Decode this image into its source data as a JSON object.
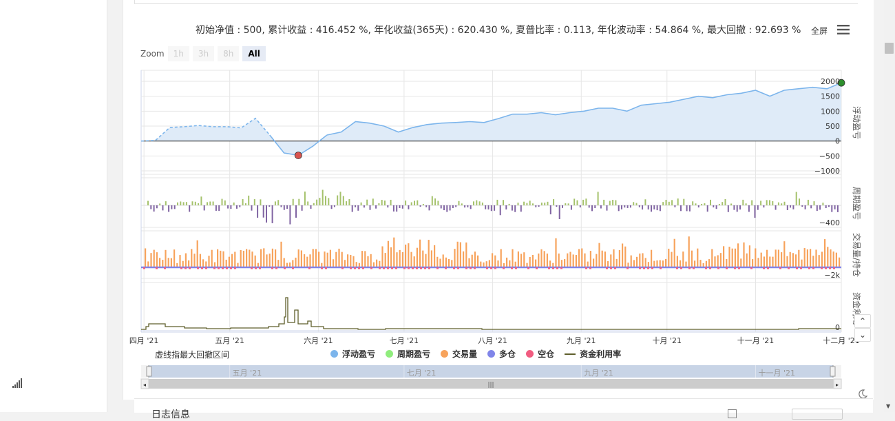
{
  "summary": {
    "text": "初始净值 : 500, 累计收益 : 416.452 %, 年化收益(365天) : 620.430 %, 夏普比率 : 0.113, 年化波动率 : 54.864 %, 最大回撤 : 92.693 %"
  },
  "toolbar": {
    "fullscreen_label": "全屏",
    "menu_icon": "hamburger-menu-icon"
  },
  "zoom": {
    "label": "Zoom",
    "buttons": [
      "1h",
      "3h",
      "8h",
      "All"
    ],
    "active": "All"
  },
  "note": "虚线指最大回撤区间",
  "legend": [
    {
      "label": "浮动盈亏",
      "color": "#7cb5ec",
      "shape": "dot"
    },
    {
      "label": "周期盈亏",
      "color": "#90ed7d",
      "shape": "dot"
    },
    {
      "label": "交易量",
      "color": "#f7a35c",
      "shape": "dot"
    },
    {
      "label": "多仓",
      "color": "#8085e9",
      "shape": "dot"
    },
    {
      "label": "空仓",
      "color": "#f15c80",
      "shape": "dot"
    },
    {
      "label": "资金利用率",
      "color": "#5e5e2a",
      "shape": "line"
    }
  ],
  "colors": {
    "equity_line": "#7cb5ec",
    "equity_fill": "#dfebf8",
    "period_pos": "#a5c26b",
    "period_neg": "#8064a2",
    "volume": "#f7a35c",
    "long": "#8085e9",
    "short": "#f15c80",
    "utilization": "#5e5e2a",
    "marker_max": "#2d8f2d",
    "marker_min": "#d9534f"
  },
  "bottom": {
    "title": "日志信息"
  },
  "chart_data": {
    "type": "line",
    "x_ticks": [
      "四月 '21",
      "五月 '21",
      "六月 '21",
      "七月 '21",
      "八月 '21",
      "九月 '21",
      "十月 '21",
      "十一月 '21",
      "十二月 '21"
    ],
    "navigator_ticks": [
      "五月 '21",
      "七月 '21",
      "九月 '21",
      "十一月 '21"
    ],
    "panes": [
      {
        "name": "浮动盈亏",
        "y_ticks": [
          "2000",
          "1500",
          "1000",
          "500",
          "0",
          "−500",
          "−1000"
        ],
        "ylim": [
          -1000,
          2000
        ],
        "x": [
          "2021-03-31",
          "2021-04-05",
          "2021-04-10",
          "2021-04-15",
          "2021-04-20",
          "2021-04-25",
          "2021-04-30",
          "2021-05-05",
          "2021-05-10",
          "2021-05-15",
          "2021-05-20",
          "2021-05-25",
          "2021-05-30",
          "2021-06-04",
          "2021-06-09",
          "2021-06-14",
          "2021-06-19",
          "2021-06-24",
          "2021-06-29",
          "2021-07-04",
          "2021-07-09",
          "2021-07-14",
          "2021-07-19",
          "2021-07-24",
          "2021-07-29",
          "2021-08-03",
          "2021-08-08",
          "2021-08-13",
          "2021-08-18",
          "2021-08-23",
          "2021-08-28",
          "2021-09-02",
          "2021-09-07",
          "2021-09-12",
          "2021-09-17",
          "2021-09-22",
          "2021-09-27",
          "2021-10-02",
          "2021-10-07",
          "2021-10-12",
          "2021-10-17",
          "2021-10-22",
          "2021-10-27",
          "2021-11-01",
          "2021-11-06",
          "2021-11-11",
          "2021-11-16",
          "2021-11-21",
          "2021-11-26",
          "2021-12-01"
        ],
        "values": [
          0,
          20,
          450,
          480,
          520,
          480,
          480,
          440,
          760,
          200,
          -400,
          -480,
          -180,
          200,
          300,
          650,
          600,
          500,
          300,
          450,
          550,
          600,
          620,
          650,
          620,
          750,
          900,
          900,
          950,
          880,
          950,
          1000,
          1100,
          1100,
          1000,
          1200,
          1250,
          1300,
          1400,
          1500,
          1450,
          1550,
          1600,
          1700,
          1500,
          1700,
          1750,
          1800,
          1750,
          1950
        ],
        "max_drawdown_range": [
          "2021-05-10",
          "2021-05-30"
        ],
        "markers": [
          {
            "x": "2021-05-25",
            "y": -480,
            "type": "min"
          },
          {
            "x": "2021-12-01",
            "y": 1950,
            "type": "max"
          }
        ]
      },
      {
        "name": "周期盈亏",
        "y_ticks": [
          "−400"
        ]
      },
      {
        "name": "交易量/持仓",
        "y_ticks": [
          "−2k"
        ]
      },
      {
        "name": "资金利用率",
        "y_ticks": [
          "0"
        ]
      }
    ],
    "pane_titles": [
      "浮动盈亏",
      "周期盈亏",
      "交易量/持仓",
      "资金利用"
    ],
    "legend_placement": "bottom"
  }
}
